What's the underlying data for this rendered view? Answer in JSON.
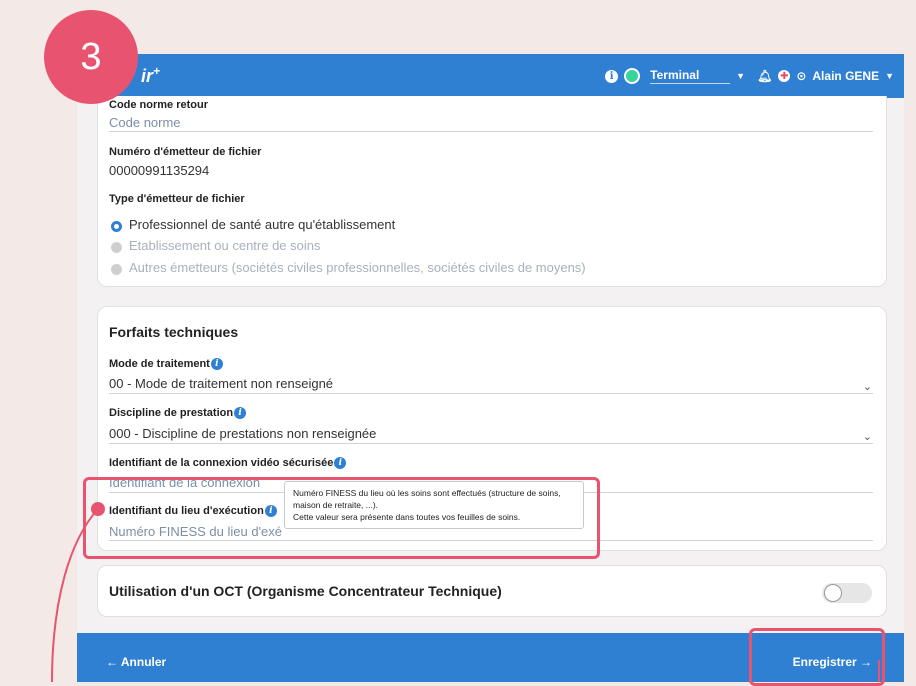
{
  "step": "3",
  "app": {
    "logo": "ir",
    "logo_star": "+",
    "terminal": "Terminal",
    "user": "Alain GENE"
  },
  "section1": {
    "code_norme_label": "Code norme retour",
    "code_norme_placeholder": "Code norme",
    "emetteur_label": "Numéro d'émetteur de fichier",
    "emetteur_value": "00000991135294",
    "type_label": "Type d'émetteur de fichier",
    "options": [
      "Professionnel de santé autre qu'établissement",
      "Etablissement ou centre de soins",
      "Autres émetteurs (sociétés civiles professionnelles, sociétés civiles de moyens)"
    ],
    "selected_index": 0
  },
  "forfaits": {
    "title": "Forfaits techniques",
    "mode_label": "Mode de traitement",
    "mode_value": "00 - Mode de traitement non renseigné",
    "discipline_label": "Discipline de prestation",
    "discipline_value": "000 - Discipline de prestations non renseignée",
    "connexion_label": "Identifiant de la connexion vidéo sécurisée",
    "connexion_placeholder": "Identifiant de la connexion",
    "lieu_label": "Identifiant du lieu d'exécution",
    "lieu_placeholder": "Numéro FINESS du lieu d'exé",
    "tooltip_line1": "Numéro FINESS du lieu où les soins sont effectués (structure de soins, maison de retraite, ...).",
    "tooltip_line2": "Cette valeur sera présente dans toutes vos feuilles de soins."
  },
  "oct": {
    "label": "Utilisation d'un OCT (Organisme Concentrateur Technique)",
    "enabled": false
  },
  "footer": {
    "cancel": "← Annuler",
    "save": "Enregistrer →"
  },
  "colors": {
    "primary": "#2f7fd3",
    "highlight": "#e8546f",
    "status": "#36d39a"
  }
}
